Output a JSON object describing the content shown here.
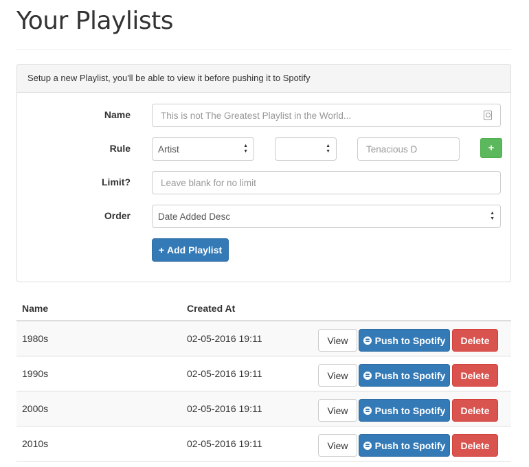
{
  "page": {
    "title": "Your Playlists"
  },
  "form": {
    "heading": "Setup a new Playlist, you'll be able to view it before pushing it to Spotify",
    "name_label": "Name",
    "name_placeholder": "This is not The Greatest Playlist in the World...",
    "rule_label": "Rule",
    "rule_field": "Artist",
    "rule_operator": "",
    "rule_value_placeholder": "Tenacious D",
    "add_rule_label": "+",
    "limit_label": "Limit?",
    "limit_placeholder": "Leave blank for no limit",
    "order_label": "Order",
    "order_value": "Date Added Desc",
    "add_playlist_label": "Add Playlist"
  },
  "table": {
    "headers": {
      "name": "Name",
      "created_at": "Created At"
    },
    "rows": [
      {
        "name": "1980s",
        "created_at": "02-05-2016 19:11",
        "view": "View",
        "push": "Push to Spotify",
        "delete": "Delete"
      },
      {
        "name": "1990s",
        "created_at": "02-05-2016 19:11",
        "view": "View",
        "push": "Push to Spotify",
        "delete": "Delete"
      },
      {
        "name": "2000s",
        "created_at": "02-05-2016 19:11",
        "view": "View",
        "push": "Push to Spotify",
        "delete": "Delete"
      },
      {
        "name": "2010s",
        "created_at": "02-05-2016 19:11",
        "view": "View",
        "push": "Push to Spotify",
        "delete": "Delete"
      }
    ]
  },
  "colors": {
    "primary": "#337ab7",
    "success": "#5cb85c",
    "danger": "#d9534f"
  }
}
